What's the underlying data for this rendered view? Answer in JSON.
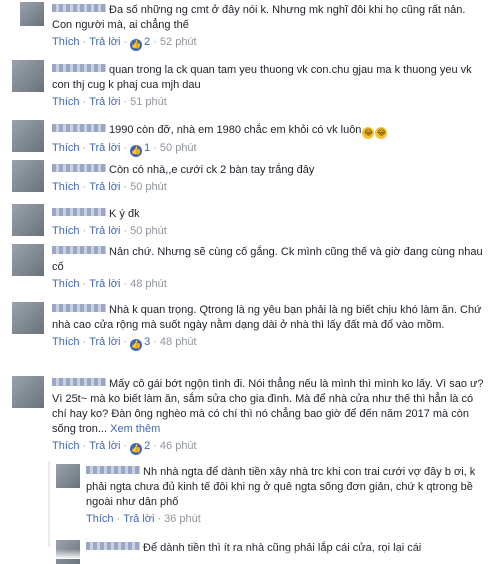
{
  "actions": {
    "like": "Thích",
    "reply": "Trả lời",
    "see_more": "Xem thêm"
  },
  "colors": {
    "link": "#4267b2",
    "meta": "#90949c",
    "text": "#1d2129"
  },
  "comments": [
    {
      "text": "Đa số những ng cmt ở đây nói k. Nhưng mk nghĩ đôi khi họ cũng rất nản. Con người mà, ai chẳng thế",
      "like_count": "2",
      "time": "52 phút"
    },
    {
      "text": "quan trong la ck quan tam yeu thuong vk con.chu gjau ma k thuong yeu vk con thj cug k phaj cua mjh dau",
      "time": "51 phút"
    },
    {
      "text": "1990 còn đỡ, nhà em 1980 chắc em khỏi có vk luôn",
      "like_count": "1",
      "time": "50 phút"
    },
    {
      "text": "Còn có nhà,,e cưới ck 2 bàn tay trắng đây",
      "time": "50 phút"
    },
    {
      "text": "K ý đk",
      "time": "50 phút"
    },
    {
      "text": "Nản chứ. Nhưng sẽ cùng cố gắng. Ck mình cũng thế và giờ đang cùng nhau cố",
      "time": "48 phút"
    },
    {
      "text": "Nhà k quan trọng. Qtrong là ng yêu bạn phải là ng biết chịu khó làm ăn. Chứ nhà cao cửa rộng mà suốt ngày nằm dạng dài ở nhà thì lấy đất mà đổ vào mồm.",
      "like_count": "3",
      "time": "48 phút"
    },
    {
      "text": "Mấy cô gái bớt ngộn tình đi. Nói thẳng nếu là mình thì mình ko lấy. Vì sao ư? Vì 25t~ mà ko biết làm ăn, sắm sửa cho gia đình. Mà để nhà cửa như thế thì hẳn là có chí hay ko? Đàn ông nghèo mà có chí thì nó chẳng bao giờ để đến năm 2017 mà còn sống tron...",
      "like_count": "2",
      "time": "46 phút"
    },
    {
      "text": "Nh nhà ngta để dành tiền xây nhà trc khi con trai cưới vợ đây b ơi, k phải ngta chưa đủ kinh tế đôi khi ng ở quê ngta sống đơn giản, chứ k qtrong bề ngoài như dân phố",
      "time": "36 phút"
    },
    {
      "text": "Để dành tiền thì ít ra nhà cũng phải lắp cái cửa, rọi lại cái"
    }
  ]
}
